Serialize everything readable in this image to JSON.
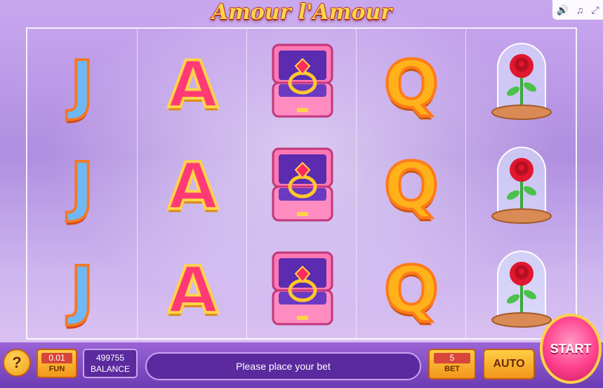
{
  "game": {
    "title": "Amour l'Amour"
  },
  "top_controls": [
    {
      "icon": "speaker-icon",
      "glyph": "🔊"
    },
    {
      "icon": "music-icon",
      "glyph": "♫"
    },
    {
      "icon": "fullscreen-icon",
      "glyph": "⤢"
    }
  ],
  "reels": [
    [
      "J",
      "J",
      "J"
    ],
    [
      "A",
      "A",
      "A"
    ],
    [
      "ring-box",
      "ring-box",
      "ring-box"
    ],
    [
      "Q",
      "Q",
      "Q"
    ],
    [
      "rose-dome",
      "rose-dome",
      "rose-dome"
    ]
  ],
  "bottom_bar": {
    "help_label": "?",
    "denomination": {
      "value": "0.01",
      "caption": "FUN"
    },
    "balance": {
      "value": "499755",
      "caption": "BALANCE"
    },
    "message": "Please place your bet",
    "bet": {
      "value": "5",
      "caption": "BET"
    },
    "auto_label": "AUTO",
    "start_label": "START"
  },
  "colors": {
    "accent_orange": "#f2961a",
    "accent_purple": "#5a2a9e",
    "start_pink": "#ff3f8b"
  }
}
